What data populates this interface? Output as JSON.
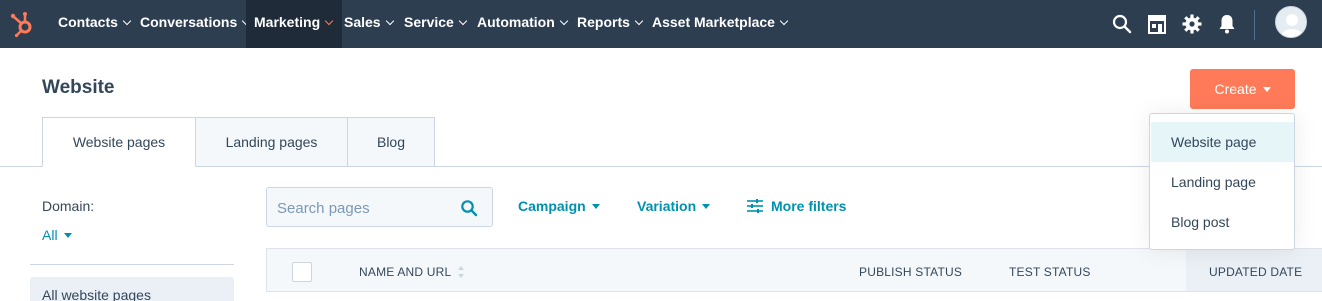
{
  "topnav": {
    "items": [
      {
        "label": "Contacts"
      },
      {
        "label": "Conversations"
      },
      {
        "label": "Marketing"
      },
      {
        "label": "Sales"
      },
      {
        "label": "Service"
      },
      {
        "label": "Automation"
      },
      {
        "label": "Reports"
      },
      {
        "label": "Asset Marketplace"
      }
    ],
    "active": "Marketing",
    "icons": [
      "search-icon",
      "marketplace-icon",
      "settings-icon",
      "notifications-icon"
    ]
  },
  "header": {
    "title": "Website",
    "create_label": "Create"
  },
  "tabs": [
    {
      "label": "Website pages",
      "active": true
    },
    {
      "label": "Landing pages",
      "active": false
    },
    {
      "label": "Blog",
      "active": false
    }
  ],
  "filters": {
    "domain_label": "Domain:",
    "domain_value": "All",
    "search_placeholder": "Search pages",
    "campaign_label": "Campaign",
    "variation_label": "Variation",
    "more_filters_label": "More filters"
  },
  "sidebar": {
    "items": [
      {
        "label": "All website pages"
      }
    ]
  },
  "table": {
    "columns": [
      "NAME AND URL",
      "PUBLISH STATUS",
      "TEST STATUS",
      "UPDATED DATE"
    ]
  },
  "create_menu": {
    "items": [
      {
        "label": "Website page"
      },
      {
        "label": "Landing page"
      },
      {
        "label": "Blog post"
      }
    ]
  },
  "colors": {
    "nav_bg": "#2d3e50",
    "accent": "#ff7a59",
    "link": "#0091ae",
    "text": "#33475b"
  }
}
